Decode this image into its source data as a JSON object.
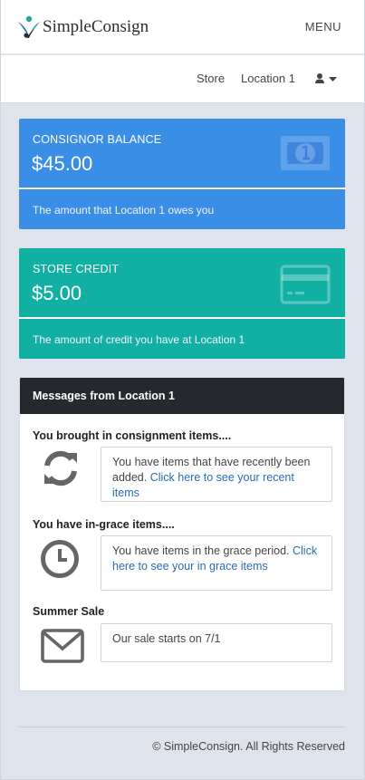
{
  "header": {
    "brand": "SimpleConsign",
    "menu_label": "MENU",
    "nav": [
      {
        "label": "Store"
      },
      {
        "label": "Location 1"
      }
    ],
    "user_icon": "user-icon",
    "caret_icon": "caret-down-icon"
  },
  "cards": {
    "balance": {
      "label": "CONSIGNOR BALANCE",
      "amount": "$45.00",
      "description": "The amount that Location 1 owes you",
      "icon": "money-bill-icon",
      "color": "#3a8ee6"
    },
    "credit": {
      "label": "STORE CREDIT",
      "amount": "$5.00",
      "description": "The amount of credit you have at Location 1",
      "icon": "credit-card-icon",
      "color": "#12b0a2"
    }
  },
  "messages": {
    "title": "Messages from Location 1",
    "items": [
      {
        "heading": "You brought in consignment items....",
        "text": "You have items that have recently been added.",
        "link": "Click here to see your recent items",
        "icon": "refresh-icon"
      },
      {
        "heading": "You have in-grace items....",
        "text": "You have items in the grace period.",
        "link": "Click here to see your in grace items",
        "icon": "clock-icon"
      },
      {
        "heading": "Summer Sale",
        "text": "Our sale starts on 7/1",
        "link": "",
        "icon": "envelope-icon"
      }
    ]
  },
  "footer": {
    "copyright": "© SimpleConsign. All Rights Reserved"
  },
  "colors": {
    "background": "#dfe4ec",
    "panel_header": "#25282d",
    "link": "#2a6ab5"
  }
}
